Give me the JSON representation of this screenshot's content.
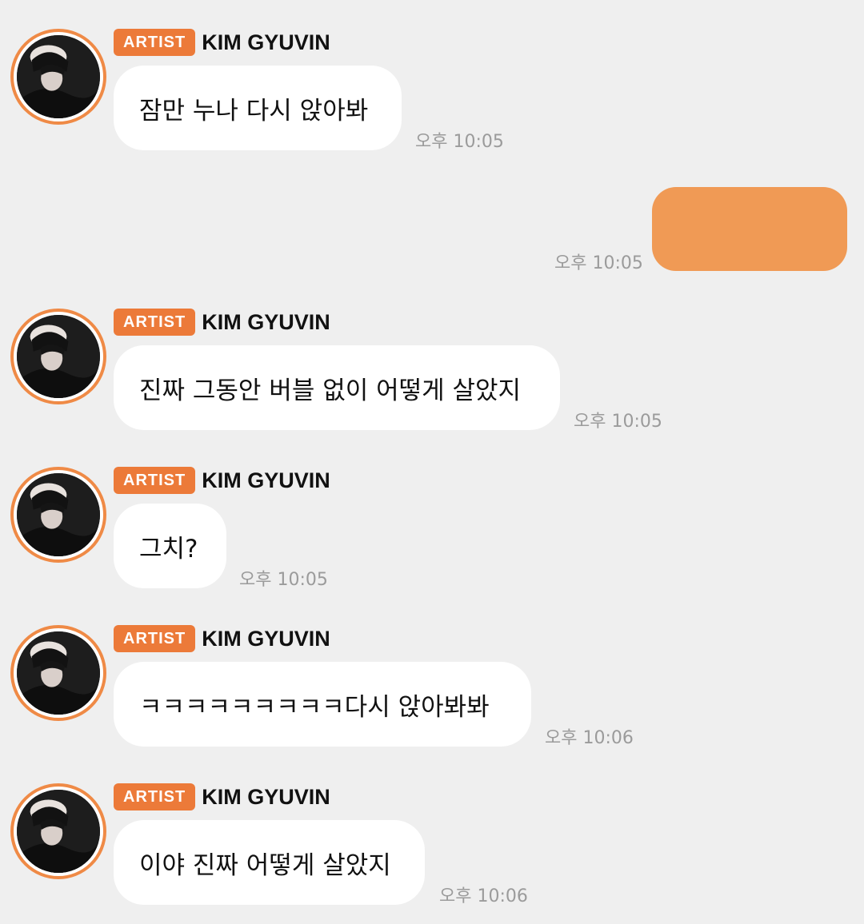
{
  "colors": {
    "background": "#efefef",
    "accent": "#ec7a39",
    "sent_bubble": "#f09a55",
    "received_bubble": "#ffffff",
    "timestamp": "#9b9b9b"
  },
  "messages": [
    {
      "badge": "ARTIST",
      "sender": "KIM GYUVIN",
      "text": "잠만 누나 다시 앉아봐",
      "time": "오후 10:05"
    },
    {
      "sent": true,
      "text": "",
      "time": "오후 10:05"
    },
    {
      "badge": "ARTIST",
      "sender": "KIM GYUVIN",
      "text": "진짜 그동안 버블 없이 어떻게 살았지",
      "time": "오후 10:05"
    },
    {
      "badge": "ARTIST",
      "sender": "KIM GYUVIN",
      "text": "그치?",
      "time": "오후 10:05"
    },
    {
      "badge": "ARTIST",
      "sender": "KIM GYUVIN",
      "text": "ㅋㅋㅋㅋㅋㅋㅋㅋㅋ다시 앉아봐봐",
      "time": "오후 10:06"
    },
    {
      "badge": "ARTIST",
      "sender": "KIM GYUVIN",
      "text": "이야 진짜 어떻게 살았지",
      "time": "오후 10:06"
    }
  ]
}
